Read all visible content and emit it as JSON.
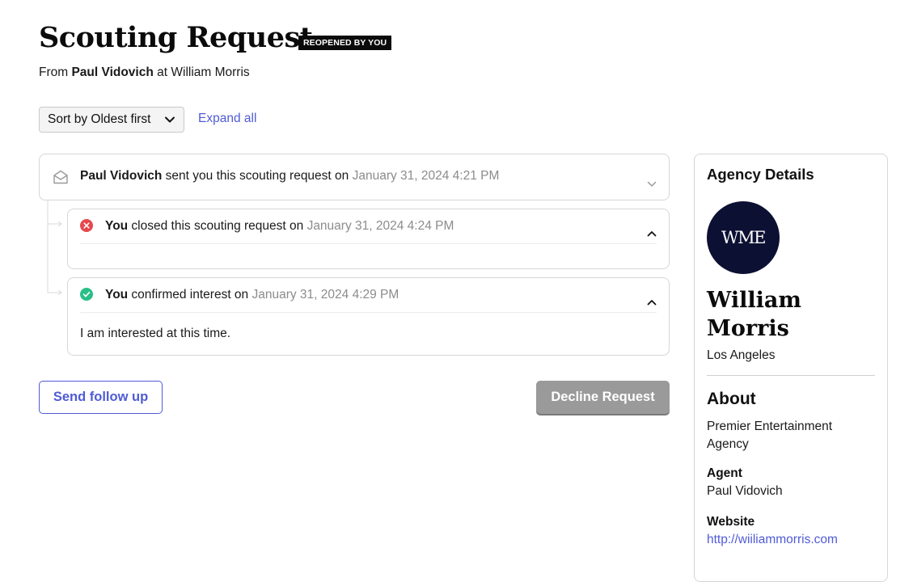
{
  "header": {
    "title": "Scouting Request",
    "badge": "REOPENED BY YOU",
    "subtitle_prefix": "From ",
    "sender": "Paul Vidovich",
    "subtitle_mid": " at ",
    "agency": "William Morris"
  },
  "controls": {
    "sort_label": "Sort by Oldest first",
    "expand_label": "Expand all"
  },
  "timeline": [
    {
      "actor": "Paul Vidovich",
      "action": " sent you this scouting request on ",
      "date": "January 31, 2024 4:21 PM"
    },
    {
      "actor": "You",
      "action": " closed this scouting request on ",
      "date": "January 31, 2024 4:24 PM",
      "status_color": "#e5484d"
    },
    {
      "actor": "You",
      "action": " confirmed interest on ",
      "date": "January 31, 2024 4:29 PM",
      "message": "I am interested at this time.",
      "status_color": "#2bbf88"
    }
  ],
  "actions": {
    "follow_up": "Send follow up",
    "decline": "Decline Request"
  },
  "agency_details": {
    "heading": "Agency Details",
    "logo_text": "WME",
    "name": "William Morris",
    "city": "Los Angeles",
    "about_heading": "About",
    "about": "Premier Entertainment Agency",
    "agent_label": "Agent",
    "agent": "Paul Vidovich",
    "website_label": "Website",
    "website": "http://wiiliammorris.com"
  },
  "colors": {
    "accent": "#4f5bd5",
    "error": "#e5484d",
    "success": "#2bbf88",
    "logo_bg": "#0c1133"
  }
}
